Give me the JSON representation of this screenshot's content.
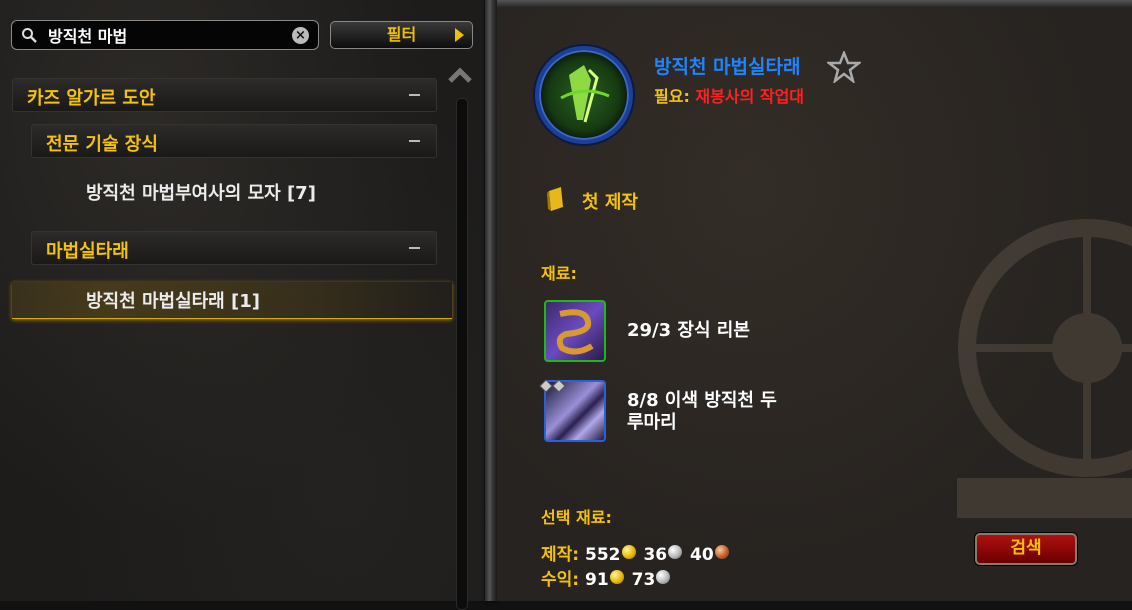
{
  "search": {
    "value": "방직천 마법",
    "placeholder": ""
  },
  "filter_button": {
    "label": "필터"
  },
  "categories": [
    {
      "label": "카즈 알가르 도안"
    },
    {
      "label": "전문 기술 장식"
    },
    {
      "label": "마법실타래"
    }
  ],
  "recipes": [
    {
      "label": "방직천 마법부여사의 모자 [7]"
    },
    {
      "label": "방직천 마법실타래 [1]"
    }
  ],
  "detail": {
    "title": "방직천 마법실타래",
    "requires_label": "필요:",
    "requires_value": "재봉사의 작업대",
    "first_craft": "첫 제작",
    "reagents_label": "재료:",
    "reagents": [
      {
        "line1": "29/3 장식 리본",
        "line2": ""
      },
      {
        "line1": "8/8 이색 방직천 두",
        "line2": "루마리"
      }
    ],
    "optional_label": "선택 재료:",
    "cost_label": "제작:",
    "cost": {
      "gold": "552",
      "silver": "36",
      "copper": "40"
    },
    "profit_label": "수익:",
    "profit": {
      "gold": "91",
      "silver": "73"
    },
    "search_button": "검색"
  },
  "colors": {
    "quality_blue": "#1f84ff",
    "header_gold": "#f4c20d",
    "requirement_red": "#ff2020"
  },
  "icons": [
    "search-icon",
    "clear-icon",
    "filter-arrow-icon",
    "collapse-icon",
    "scroll-up-icon",
    "recipe-thread-icon",
    "favorite-star-icon",
    "book-icon",
    "ribbon-reagent-icon",
    "cloth-bolt-reagent-icon",
    "gold-coin-icon",
    "silver-coin-icon",
    "copper-coin-icon"
  ]
}
